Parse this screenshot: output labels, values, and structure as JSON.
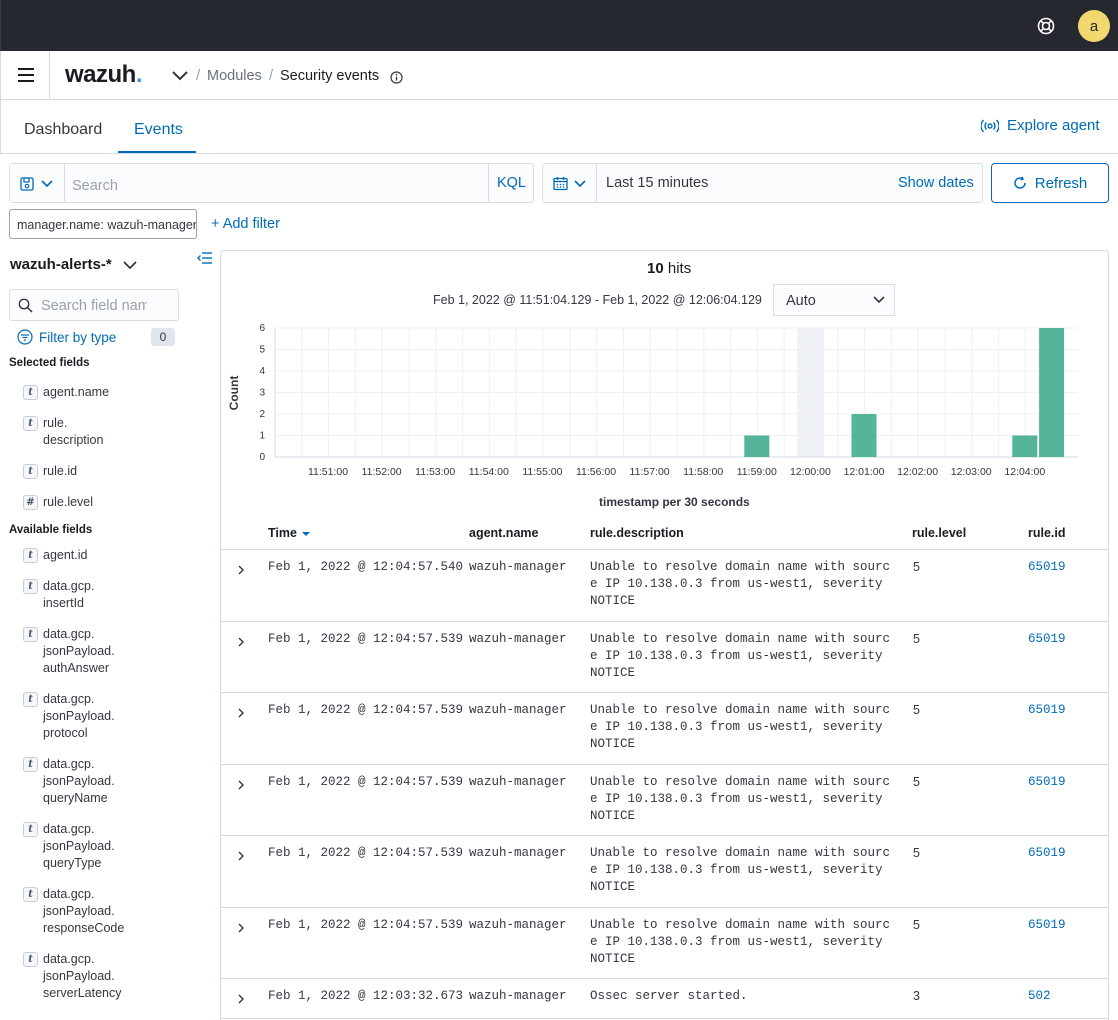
{
  "topbar": {
    "avatar_initial": "a"
  },
  "header": {
    "logo": "wazuh",
    "logo_dot": ".",
    "breadcrumbs": [
      "Modules",
      "Security events"
    ],
    "separators": [
      "/",
      "/"
    ]
  },
  "tabs": {
    "items": [
      "Dashboard",
      "Events"
    ],
    "active": "Events",
    "explore_agent": "Explore agent"
  },
  "query": {
    "search_placeholder": "Search",
    "language": "KQL",
    "time_range": "Last 15 minutes",
    "show_dates": "Show dates",
    "refresh_label": "Refresh"
  },
  "filters": {
    "pill": "manager.name: wazuh-manager",
    "add_filter": "+ Add filter"
  },
  "sidebar": {
    "index_pattern": "wazuh-alerts-*",
    "search_placeholder": "Search field names",
    "filter_by_type": "Filter by type",
    "type_count": "0",
    "selected_title": "Selected fields",
    "available_title": "Available fields",
    "selected_fields": [
      {
        "type": "t",
        "lines": [
          "agent.name"
        ]
      },
      {
        "type": "t",
        "lines": [
          "rule.",
          "description"
        ]
      },
      {
        "type": "t",
        "lines": [
          "rule.id"
        ]
      },
      {
        "type": "#",
        "lines": [
          "rule.level"
        ]
      }
    ],
    "available_fields": [
      {
        "type": "t",
        "lines": [
          "agent.id"
        ]
      },
      {
        "type": "t",
        "lines": [
          "data.gcp.",
          "insertId"
        ]
      },
      {
        "type": "t",
        "lines": [
          "data.gcp.",
          "jsonPayload.",
          "authAnswer"
        ]
      },
      {
        "type": "t",
        "lines": [
          "data.gcp.",
          "jsonPayload.",
          "protocol"
        ]
      },
      {
        "type": "t",
        "lines": [
          "data.gcp.",
          "jsonPayload.",
          "queryName"
        ]
      },
      {
        "type": "t",
        "lines": [
          "data.gcp.",
          "jsonPayload.",
          "queryType"
        ]
      },
      {
        "type": "t",
        "lines": [
          "data.gcp.",
          "jsonPayload.",
          "responseCode"
        ]
      },
      {
        "type": "t",
        "lines": [
          "data.gcp.",
          "jsonPayload.",
          "serverLatency"
        ]
      }
    ]
  },
  "results": {
    "hits_count": "10",
    "hits_label": "hits",
    "date_range": "Feb 1, 2022 @ 11:51:04.129 - Feb 1, 2022 @ 12:06:04.129",
    "interval": "Auto"
  },
  "chart_data": {
    "type": "bar",
    "xlabel": "timestamp per 30 seconds",
    "ylabel": "Count",
    "ylim": [
      0,
      6
    ],
    "yticks": [
      "0",
      "1",
      "2",
      "3",
      "4",
      "5",
      "6"
    ],
    "xticks": [
      "11:51:00",
      "11:52:00",
      "11:53:00",
      "11:54:00",
      "11:55:00",
      "11:56:00",
      "11:57:00",
      "11:58:00",
      "11:59:00",
      "12:00:00",
      "12:01:00",
      "12:02:00",
      "12:03:00",
      "12:04:00"
    ],
    "bars": [
      {
        "x": "11:59:00",
        "value": 1
      },
      {
        "x": "12:01:00",
        "value": 2
      },
      {
        "x": "12:04:00",
        "value": 1
      },
      {
        "x": "12:04:30",
        "value": 6
      }
    ],
    "bar_color": "#54b399",
    "highlight_band_at": "12:00:00"
  },
  "table": {
    "columns": [
      "Time",
      "agent.name",
      "rule.description",
      "rule.level",
      "rule.id"
    ],
    "rows": [
      {
        "time": "Feb 1, 2022 @ 12:04:57.540",
        "agent": "wazuh-manager",
        "desc": "Unable to resolve domain name with source IP 10.138.0.3 from us-west1, severity NOTICE",
        "level": "5",
        "id": "65019"
      },
      {
        "time": "Feb 1, 2022 @ 12:04:57.539",
        "agent": "wazuh-manager",
        "desc": "Unable to resolve domain name with source IP 10.138.0.3 from us-west1, severity NOTICE",
        "level": "5",
        "id": "65019"
      },
      {
        "time": "Feb 1, 2022 @ 12:04:57.539",
        "agent": "wazuh-manager",
        "desc": "Unable to resolve domain name with source IP 10.138.0.3 from us-west1, severity NOTICE",
        "level": "5",
        "id": "65019"
      },
      {
        "time": "Feb 1, 2022 @ 12:04:57.539",
        "agent": "wazuh-manager",
        "desc": "Unable to resolve domain name with source IP 10.138.0.3 from us-west1, severity NOTICE",
        "level": "5",
        "id": "65019"
      },
      {
        "time": "Feb 1, 2022 @ 12:04:57.539",
        "agent": "wazuh-manager",
        "desc": "Unable to resolve domain name with source IP 10.138.0.3 from us-west1, severity NOTICE",
        "level": "5",
        "id": "65019"
      },
      {
        "time": "Feb 1, 2022 @ 12:04:57.539",
        "agent": "wazuh-manager",
        "desc": "Unable to resolve domain name with source IP 10.138.0.3 from us-west1, severity NOTICE",
        "level": "5",
        "id": "65019"
      },
      {
        "time": "Feb 1, 2022 @ 12:03:32.673",
        "agent": "wazuh-manager",
        "desc": "Ossec server started.",
        "level": "3",
        "id": "502"
      }
    ]
  },
  "colors": {
    "accent": "#006bb8",
    "topbar": "#25282f",
    "avatar": "#f1d86f",
    "bar": "#54b399"
  }
}
